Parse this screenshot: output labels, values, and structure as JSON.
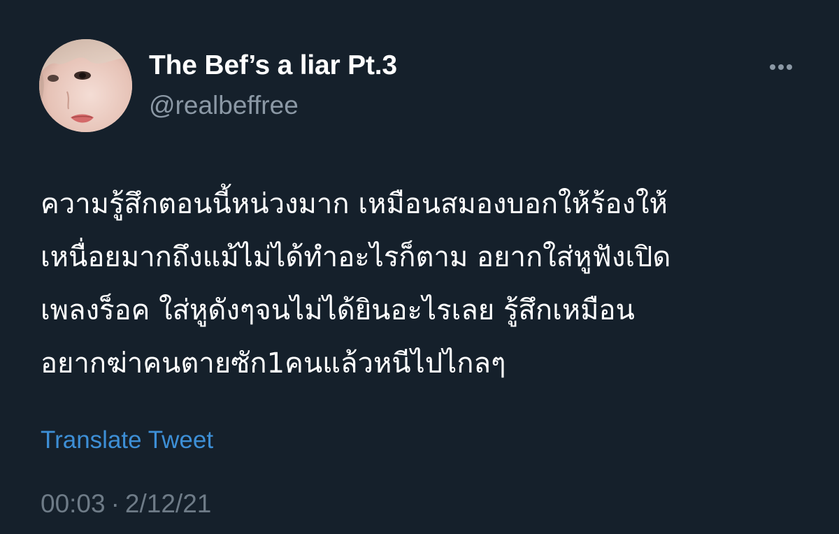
{
  "theme": {
    "background": "#15202b",
    "text_primary": "#ffffff",
    "text_secondary": "#8b98a5",
    "link": "#3d8fd6",
    "timestamp": "#6e7b87"
  },
  "author": {
    "display_name": "The Bef’s a liar Pt.3",
    "handle": "@realbeffree",
    "avatar_icon": "avatar-photo"
  },
  "more_icon": "more-horizontal-icon",
  "tweet": {
    "lines": [
      "ความรู้สึกตอนนี้หน่วงมาก เหมือนสมองบอกให้ร้องให้",
      "เหนื่อยมากถึงแม้ไม่ได้ทำอะไรก็ตาม อยากใส่หูฟังเปิด",
      "เพลงร็อค ใส่หูดังๆจนไม่ได้ยินอะไรเลย รู้สึกเหมือน",
      "อยากฆ่าคนตายซัก1คนแล้วหนีไปไกลๆ"
    ]
  },
  "translate_label": "Translate Tweet",
  "meta": {
    "time": "00:03",
    "separator": "·",
    "date": "2/12/21"
  }
}
